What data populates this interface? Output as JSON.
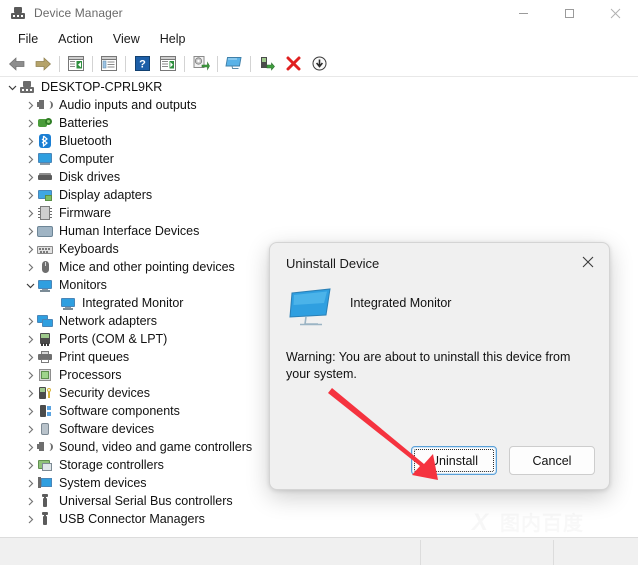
{
  "window": {
    "title": "Device Manager",
    "app_icon": "device-manager-icon",
    "controls": {
      "minimize": "—",
      "maximize": "□",
      "close": "✕"
    }
  },
  "menu": {
    "items": [
      "File",
      "Action",
      "View",
      "Help"
    ]
  },
  "toolbar": {
    "buttons": [
      {
        "name": "back-button",
        "icon": "left-arrow-icon"
      },
      {
        "name": "forward-button",
        "icon": "right-arrow-icon"
      },
      {
        "name": "separator-1",
        "icon": "separator"
      },
      {
        "name": "show-hide-console-tree-button",
        "icon": "console-tree-icon"
      },
      {
        "name": "separator-2",
        "icon": "separator"
      },
      {
        "name": "properties-button",
        "icon": "properties-icon"
      },
      {
        "name": "separator-3",
        "icon": "separator"
      },
      {
        "name": "help-button",
        "icon": "help-question-icon"
      },
      {
        "name": "show-hide-action-pane-button",
        "icon": "action-pane-icon"
      },
      {
        "name": "separator-4",
        "icon": "separator"
      },
      {
        "name": "update-driver-button",
        "icon": "update-driver-icon"
      },
      {
        "name": "separator-5",
        "icon": "separator"
      },
      {
        "name": "scan-for-hardware-changes-button",
        "icon": "scan-monitor-icon"
      },
      {
        "name": "separator-6",
        "icon": "separator"
      },
      {
        "name": "enable-device-button",
        "icon": "enable-device-icon"
      },
      {
        "name": "uninstall-device-button",
        "icon": "red-x-icon"
      },
      {
        "name": "disable-device-button",
        "icon": "down-arrow-circle-icon"
      }
    ]
  },
  "tree": {
    "root": {
      "label": "DESKTOP-CPRL9KR",
      "icon": "computer-root-icon",
      "expanded": true
    },
    "nodes": [
      {
        "label": "Audio inputs and outputs",
        "icon": "speaker-icon",
        "expandable": true,
        "expanded": false,
        "indent": 1
      },
      {
        "label": "Batteries",
        "icon": "battery-icon",
        "expandable": true,
        "expanded": false,
        "indent": 1
      },
      {
        "label": "Bluetooth",
        "icon": "bluetooth-icon",
        "expandable": true,
        "expanded": false,
        "indent": 1
      },
      {
        "label": "Computer",
        "icon": "computer-icon",
        "expandable": true,
        "expanded": false,
        "indent": 1
      },
      {
        "label": "Disk drives",
        "icon": "disk-drive-icon",
        "expandable": true,
        "expanded": false,
        "indent": 1
      },
      {
        "label": "Display adapters",
        "icon": "display-adapter-icon",
        "expandable": true,
        "expanded": false,
        "indent": 1
      },
      {
        "label": "Firmware",
        "icon": "firmware-icon",
        "expandable": true,
        "expanded": false,
        "indent": 1
      },
      {
        "label": "Human Interface Devices",
        "icon": "hid-icon",
        "expandable": true,
        "expanded": false,
        "indent": 1
      },
      {
        "label": "Keyboards",
        "icon": "keyboard-icon",
        "expandable": true,
        "expanded": false,
        "indent": 1
      },
      {
        "label": "Mice and other pointing devices",
        "icon": "mouse-icon",
        "expandable": true,
        "expanded": false,
        "indent": 1
      },
      {
        "label": "Monitors",
        "icon": "monitor-icon",
        "expandable": true,
        "expanded": true,
        "indent": 1
      },
      {
        "label": "Integrated Monitor",
        "icon": "monitor-icon",
        "expandable": false,
        "expanded": false,
        "indent": 2
      },
      {
        "label": "Network adapters",
        "icon": "network-adapter-icon",
        "expandable": true,
        "expanded": false,
        "indent": 1
      },
      {
        "label": "Ports (COM & LPT)",
        "icon": "port-icon",
        "expandable": true,
        "expanded": false,
        "indent": 1
      },
      {
        "label": "Print queues",
        "icon": "printer-icon",
        "expandable": true,
        "expanded": false,
        "indent": 1
      },
      {
        "label": "Processors",
        "icon": "processor-icon",
        "expandable": true,
        "expanded": false,
        "indent": 1
      },
      {
        "label": "Security devices",
        "icon": "security-device-icon",
        "expandable": true,
        "expanded": false,
        "indent": 1
      },
      {
        "label": "Software components",
        "icon": "software-component-icon",
        "expandable": true,
        "expanded": false,
        "indent": 1
      },
      {
        "label": "Software devices",
        "icon": "software-device-icon",
        "expandable": true,
        "expanded": false,
        "indent": 1
      },
      {
        "label": "Sound, video and game controllers",
        "icon": "speaker-icon",
        "expandable": true,
        "expanded": false,
        "indent": 1
      },
      {
        "label": "Storage controllers",
        "icon": "storage-controller-icon",
        "expandable": true,
        "expanded": false,
        "indent": 1
      },
      {
        "label": "System devices",
        "icon": "system-device-icon",
        "expandable": true,
        "expanded": false,
        "indent": 1
      },
      {
        "label": "Universal Serial Bus controllers",
        "icon": "usb-icon",
        "expandable": true,
        "expanded": false,
        "indent": 1
      },
      {
        "label": "USB Connector Managers",
        "icon": "usb-icon",
        "expandable": true,
        "expanded": false,
        "indent": 1
      }
    ]
  },
  "dialog": {
    "title": "Uninstall Device",
    "close_icon": "close-icon",
    "device_icon": "monitor-icon",
    "device_name": "Integrated Monitor",
    "warning": "Warning: You are about to uninstall this device from your system.",
    "buttons": {
      "primary": "Uninstall",
      "secondary": "Cancel"
    },
    "focused_button": "Uninstall"
  },
  "annotation": {
    "arrow_color": "#f5333f",
    "points_to": "Uninstall"
  },
  "watermark": {
    "mark": "X",
    "text": "图内百度"
  },
  "colors": {
    "accent_blue": "#2f9fe0",
    "focus_blue": "#5aa0d8",
    "dialog_bg": "#f0f0f0",
    "arrow_red": "#f5333f",
    "toolbar_red_x": "#e02020"
  },
  "statusbar": {
    "text": ""
  }
}
